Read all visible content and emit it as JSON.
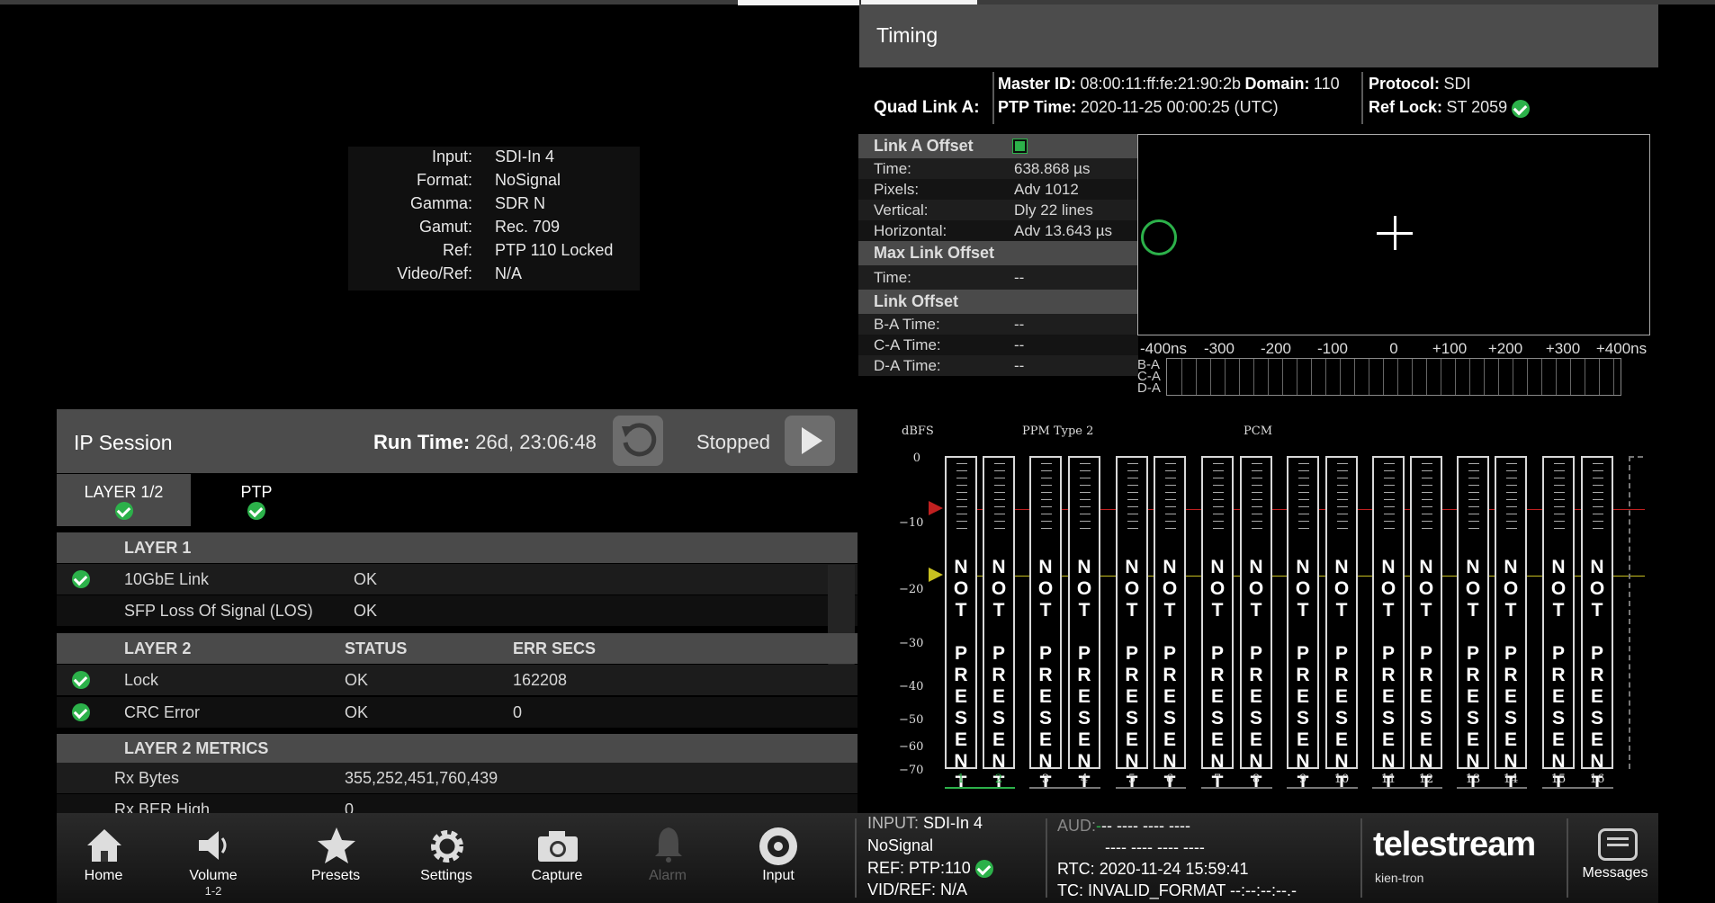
{
  "input_info": {
    "rows": [
      {
        "label": "Input:",
        "value": "SDI-In 4"
      },
      {
        "label": "Format:",
        "value": "NoSignal"
      },
      {
        "label": "Gamma:",
        "value": "SDR N"
      },
      {
        "label": "Gamut:",
        "value": "Rec. 709"
      },
      {
        "label": "Ref:",
        "value": "PTP 110 Locked"
      },
      {
        "label": "Video/Ref:",
        "value": "N/A"
      }
    ]
  },
  "timing": {
    "title": "Timing",
    "quad_link": "Quad Link A:",
    "master_id_label": "Master ID:",
    "master_id": "08:00:11:ff:fe:21:90:2b",
    "domain_label": "Domain:",
    "domain": "110",
    "protocol_label": "Protocol:",
    "protocol": "SDI",
    "ptp_time_label": "PTP Time:",
    "ptp_time": "2020-11-25 00:00:25 (UTC)",
    "ref_lock_label": "Ref Lock:",
    "ref_lock": "ST 2059",
    "link_a_offset": "Link A Offset",
    "time_label": "Time:",
    "time": "638.868 µs",
    "pixels_label": "Pixels:",
    "pixels": "Adv 1012",
    "vertical_label": "Vertical:",
    "vertical": "Dly 22 lines",
    "horizontal_label": "Horizontal:",
    "horizontal": "Adv 13.643 µs",
    "max_link_offset": "Max Link Offset",
    "max_time_label": "Time:",
    "max_time": "--",
    "link_offset": "Link Offset",
    "ba_time_label": "B-A Time:",
    "ba_time": "--",
    "ca_time_label": "C-A Time:",
    "ca_time": "--",
    "da_time_label": "D-A Time:",
    "da_time": "--",
    "scale_ticks": [
      "-400ns",
      "-300",
      "-200",
      "-100",
      "0",
      "+100",
      "+200",
      "+300",
      "+400ns"
    ],
    "bar_labels": [
      "B-A",
      "C-A",
      "D-A"
    ]
  },
  "audio": {
    "unit": "dBFS",
    "mode": "PPM Type 2",
    "format": "PCM",
    "db_ticks": [
      "0",
      "−10",
      "−20",
      "−30",
      "−40",
      "−50",
      "−60",
      "−70"
    ],
    "channels": [
      "1",
      "2",
      "3",
      "4",
      "5",
      "6",
      "7",
      "8",
      "9",
      "10",
      "11",
      "12",
      "13",
      "14",
      "15",
      "16"
    ],
    "not_present": "NOT PRESENT"
  },
  "ip_session": {
    "title": "IP Session",
    "run_time_label": "Run Time:",
    "run_time": "26d, 23:06:48",
    "state": "Stopped",
    "tabs": [
      "LAYER 1/2",
      "PTP"
    ],
    "layer1": {
      "header": "LAYER 1",
      "rows": [
        {
          "name": "10GbE Link",
          "status": "OK"
        },
        {
          "name": "SFP Loss Of Signal (LOS)",
          "status": "OK"
        }
      ]
    },
    "layer2": {
      "header": "LAYER 2",
      "status_header": "STATUS",
      "err_header": "ERR SECS",
      "rows": [
        {
          "name": "Lock",
          "status": "OK",
          "err": "162208"
        },
        {
          "name": "CRC Error",
          "status": "OK",
          "err": "0"
        }
      ]
    },
    "metrics": {
      "header": "LAYER 2 METRICS",
      "rows": [
        {
          "name": "Rx Bytes",
          "value": "355,252,451,760,439"
        },
        {
          "name": "Rx BER High",
          "value": "0"
        }
      ]
    }
  },
  "nav": {
    "home": "Home",
    "volume": "Volume",
    "volume_sub": "1-2",
    "presets": "Presets",
    "settings": "Settings",
    "capture": "Capture",
    "alarm": "Alarm",
    "input": "Input",
    "messages": "Messages"
  },
  "status": {
    "input_label": "INPUT:",
    "input": "SDI-In 4",
    "format": "NoSignal",
    "ref_label": "REF:",
    "ref": "PTP:110",
    "vidref_label": "VID/REF:",
    "vidref": "N/A",
    "aud_label": "AUD:",
    "aud_line1": "-- ---- ---- ----",
    "aud_line2": "---- ---- ---- ----",
    "rtc_label": "RTC:",
    "rtc": "2020-11-24 15:59:41",
    "tc_label": "TC:",
    "tc": "INVALID_FORMAT --:--:--:--.-"
  },
  "brand": {
    "name": "telestream",
    "sub": "kien-tron"
  }
}
